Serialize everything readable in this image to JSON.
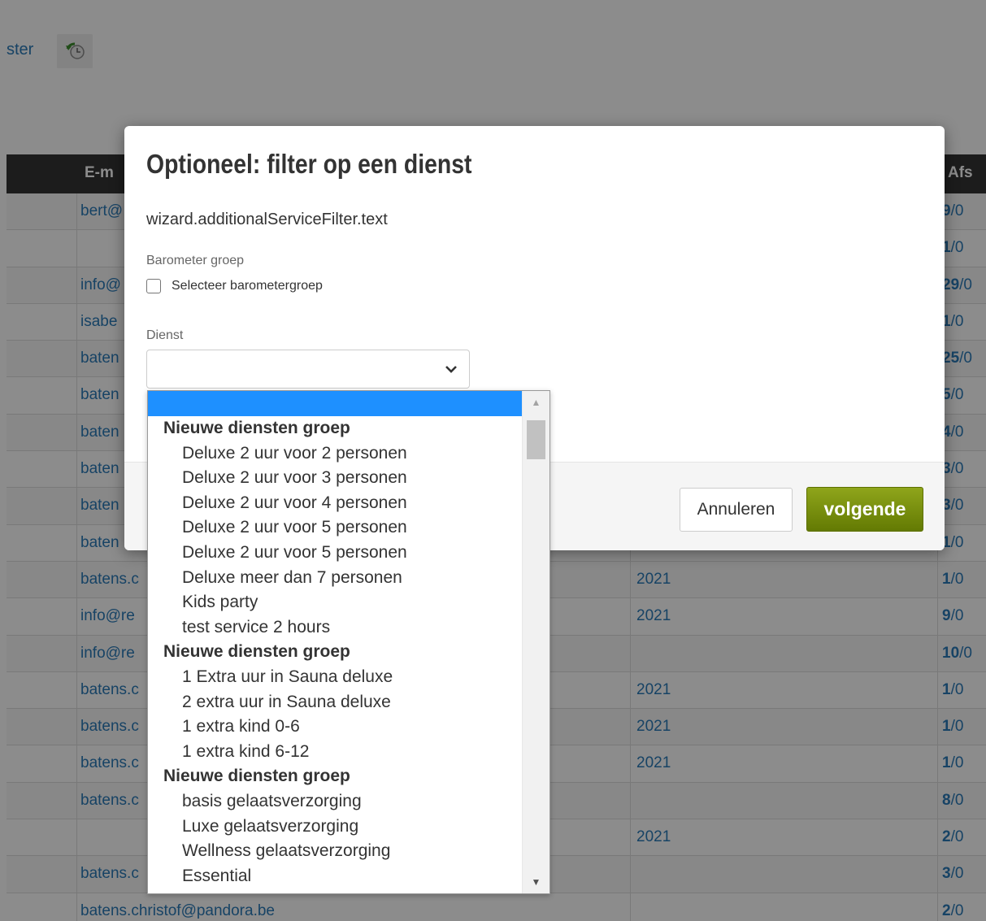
{
  "toolbar": {
    "link_text": "ster",
    "history_icon": "history-refresh-icon"
  },
  "table": {
    "headers": {
      "email": "E-m",
      "afspraken": "Afs"
    },
    "rows": [
      {
        "email": "bert@",
        "year": "",
        "afs_main": "9",
        "afs_rest": "/0"
      },
      {
        "email": "",
        "year": "",
        "afs_main": "1",
        "afs_rest": "/0"
      },
      {
        "email": "info@",
        "year": "",
        "afs_main": "29",
        "afs_rest": "/0"
      },
      {
        "email": "isabe",
        "year": "",
        "afs_main": "1",
        "afs_rest": "/0"
      },
      {
        "email": "baten",
        "year": "",
        "afs_main": "25",
        "afs_rest": "/0"
      },
      {
        "email": "baten",
        "year": "",
        "afs_main": "5",
        "afs_rest": "/0"
      },
      {
        "email": "baten",
        "year": "",
        "afs_main": "4",
        "afs_rest": "/0"
      },
      {
        "email": "baten",
        "year": "",
        "afs_main": "3",
        "afs_rest": "/0"
      },
      {
        "email": "baten",
        "year": "",
        "afs_main": "3",
        "afs_rest": "/0"
      },
      {
        "email": "baten",
        "year": "",
        "afs_main": "1",
        "afs_rest": "/0"
      },
      {
        "email": "batens.c",
        "year": "2021",
        "afs_main": "1",
        "afs_rest": "/0"
      },
      {
        "email": "info@re",
        "year": "2021",
        "afs_main": "9",
        "afs_rest": "/0"
      },
      {
        "email": "info@re",
        "year": "",
        "afs_main": "10",
        "afs_rest": "/0"
      },
      {
        "email": "batens.c",
        "year": "2021",
        "afs_main": "1",
        "afs_rest": "/0"
      },
      {
        "email": "batens.c",
        "year": "2021",
        "afs_main": "1",
        "afs_rest": "/0"
      },
      {
        "email": "batens.c",
        "year": "2021",
        "afs_main": "1",
        "afs_rest": "/0"
      },
      {
        "email": "batens.c",
        "year": "",
        "afs_main": "8",
        "afs_rest": "/0"
      },
      {
        "email": "",
        "year": "2021",
        "afs_main": "2",
        "afs_rest": "/0"
      },
      {
        "email": "batens.c",
        "year": "",
        "afs_main": "3",
        "afs_rest": "/0"
      },
      {
        "email": "batens.christof@pandora.be",
        "year": "",
        "afs_main": "2",
        "afs_rest": "/0"
      }
    ]
  },
  "modal": {
    "title": "Optioneel: filter op een dienst",
    "text": "wizard.additionalServiceFilter.text",
    "barometer_label": "Barometer groep",
    "barometer_checkbox_label": "Selecteer barometergroep",
    "barometer_checked": false,
    "dienst_label": "Dienst",
    "dienst_value": "",
    "cancel_label": "Annuleren",
    "next_label": "volgende"
  },
  "dropdown": {
    "options": [
      {
        "type": "selected",
        "label": ""
      },
      {
        "type": "group",
        "label": "Nieuwe diensten groep"
      },
      {
        "type": "item",
        "label": "Deluxe 2 uur voor 2 personen"
      },
      {
        "type": "item",
        "label": "Deluxe 2 uur voor 3 personen"
      },
      {
        "type": "item",
        "label": "Deluxe 2 uur voor 4 personen"
      },
      {
        "type": "item",
        "label": "Deluxe 2 uur voor 5 personen"
      },
      {
        "type": "item",
        "label": "Deluxe 2 uur voor 5 personen"
      },
      {
        "type": "item",
        "label": "Deluxe meer dan 7 personen"
      },
      {
        "type": "item",
        "label": "Kids party"
      },
      {
        "type": "item",
        "label": "test service 2 hours"
      },
      {
        "type": "group",
        "label": "Nieuwe diensten groep"
      },
      {
        "type": "item",
        "label": "1 Extra uur in Sauna deluxe"
      },
      {
        "type": "item",
        "label": "2 extra uur in Sauna deluxe"
      },
      {
        "type": "item",
        "label": "1 extra kind 0-6"
      },
      {
        "type": "item",
        "label": "1 extra kind 6-12"
      },
      {
        "type": "group",
        "label": "Nieuwe diensten groep"
      },
      {
        "type": "item",
        "label": "basis gelaatsverzorging"
      },
      {
        "type": "item",
        "label": "Luxe gelaatsverzorging"
      },
      {
        "type": "item",
        "label": "Wellness gelaatsverzorging"
      },
      {
        "type": "item",
        "label": "Essential"
      }
    ]
  },
  "colors": {
    "link": "#2a7ab8",
    "primary_button": "#7a9010",
    "selected_option": "#1e90ff",
    "header_bg": "#333333"
  }
}
